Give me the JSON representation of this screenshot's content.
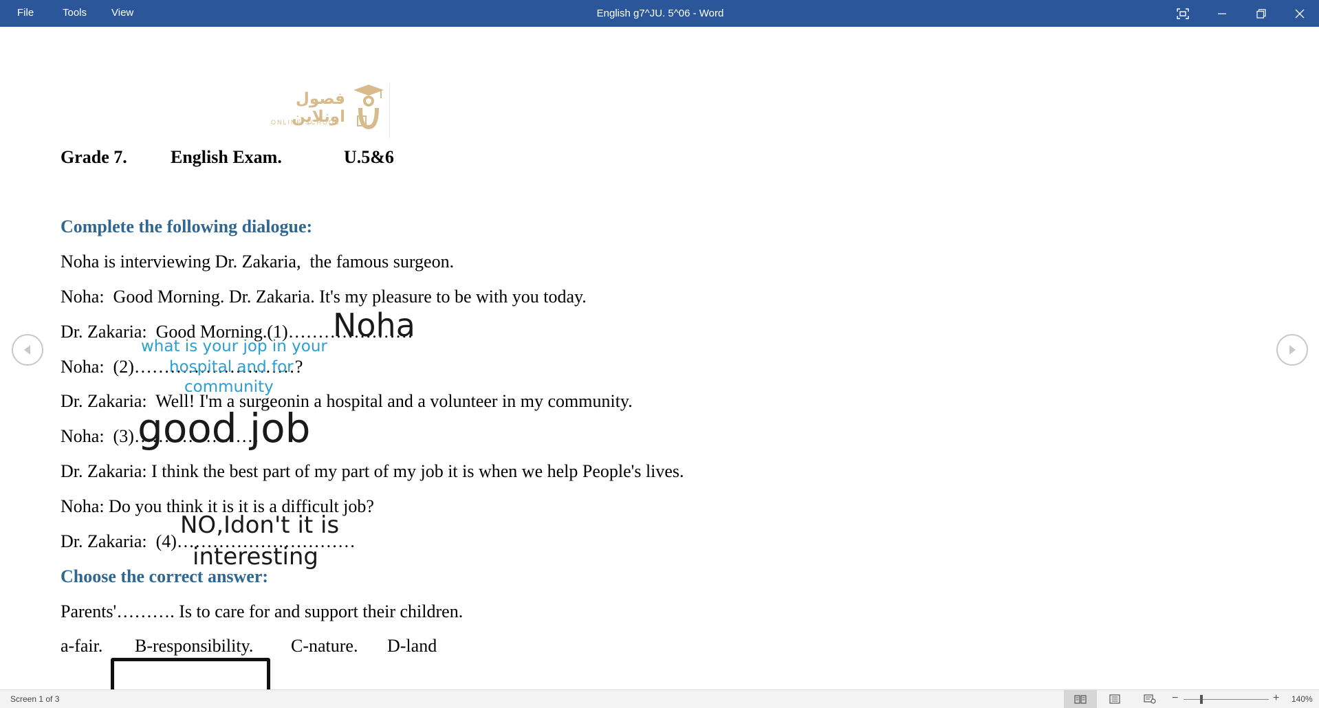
{
  "titlebar": {
    "menu": [
      "File",
      "Tools",
      "View"
    ],
    "title": "English g7^JU. 5^06  -  Word",
    "accent": "#2b579a"
  },
  "logo": {
    "arabic": "فصول اونلاين",
    "english": "ONLINE SCHOOL",
    "color": "#d7bb8d"
  },
  "document": {
    "header": [
      "Grade 7.",
      "English Exam.",
      "U.5&6"
    ],
    "section1_heading": "Complete the following dialogue:",
    "heading_color": "#2e6792",
    "lines": [
      "Noha is interviewing Dr. Zakaria,  the famous surgeon.",
      "Noha:  Good Morning. Dr. Zakaria. It's my pleasure to be with you today.",
      "Dr. Zakaria:  Good Morning.(1)…………………",
      "Noha:  (2)………………………?",
      "Dr. Zakaria:  Well! I'm a surgeonin a hospital and a volunteer in my community.",
      "Noha:  (3)…………………",
      "Dr. Zakaria: I think the best part of my part of my job it is when we help People's lives.",
      "Noha: Do you think it is it is a difficult job?",
      "Dr. Zakaria:  (4)…………………………"
    ],
    "section2_heading": "Choose the correct answer:",
    "question": "Parents'………. Is to care for and support their children.",
    "options": [
      "a-fair.",
      "B-responsibility.",
      "C-nature.",
      "D-land"
    ],
    "selected_option": "B-responsibility."
  },
  "handwriting": {
    "answer1": "Noha",
    "answer2_line1": "what is your jop in your",
    "answer2_line2": "hospital and for",
    "answer2_line3": "community",
    "answer3": "good job",
    "answer4_line1": "NO,Idon't it is",
    "answer4_line2": "interesting",
    "blue_ink": "#2b9fd4"
  },
  "statusbar": {
    "page_info": "Screen 1 of 3",
    "zoom": "140%",
    "zoom_minus": "−",
    "zoom_plus": "+"
  },
  "icons": {
    "prev": "chevron-left-circle-icon",
    "next": "chevron-right-circle-icon",
    "fullscreen": "fullscreen-icon",
    "minimize": "minimize-icon",
    "restore": "restore-icon",
    "close": "close-icon"
  }
}
